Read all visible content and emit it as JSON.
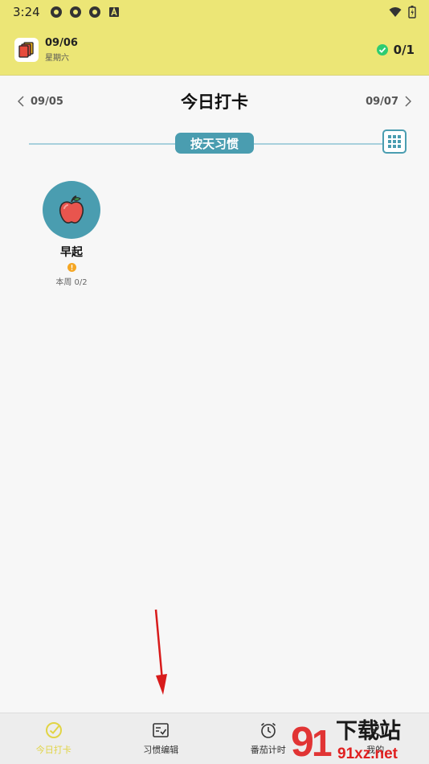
{
  "status_bar": {
    "time": "3:24"
  },
  "header": {
    "date": "09/06",
    "weekday": "星期六",
    "progress": "0/1"
  },
  "nav": {
    "prev": "09/05",
    "title": "今日打卡",
    "next": "09/07"
  },
  "mode_tag": "按天习惯",
  "habits": [
    {
      "name": "早起",
      "week": "本周 0/2"
    }
  ],
  "tabs": [
    {
      "label": "今日打卡"
    },
    {
      "label": "习惯编辑"
    },
    {
      "label": "番茄计时"
    },
    {
      "label": "我的"
    }
  ],
  "watermark": {
    "line1": "下载站",
    "line2": "91xz.net"
  },
  "colors": {
    "header_bg": "#ece676",
    "accent": "#4a9db0",
    "active_tab": "#e1d445",
    "arrow": "#d81b1b"
  }
}
